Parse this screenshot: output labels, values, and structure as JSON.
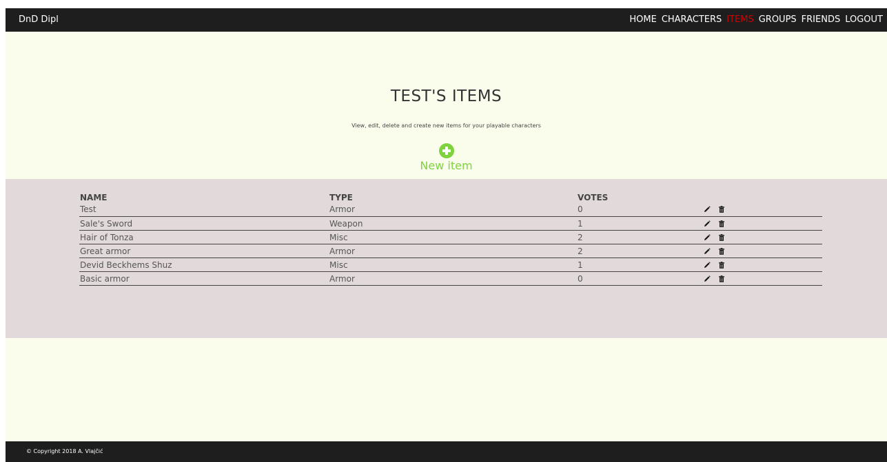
{
  "navbar": {
    "brand": "DnD Dipl",
    "links": [
      {
        "label": "HOME",
        "active": false
      },
      {
        "label": "CHARACTERS",
        "active": false
      },
      {
        "label": "ITEMS",
        "active": true
      },
      {
        "label": "GROUPS",
        "active": false
      },
      {
        "label": "FRIENDS",
        "active": false
      },
      {
        "label": "LOGOUT",
        "active": false
      }
    ],
    "active_color": "#d40000"
  },
  "header": {
    "title": "TEST'S ITEMS",
    "subtitle": "View, edit, delete and create new items for your playable characters",
    "new_item_label": "New item",
    "new_item_icon": "plus-circle-icon",
    "accent_color": "#7ed33f"
  },
  "table": {
    "columns": [
      "NAME",
      "TYPE",
      "VOTES"
    ],
    "rows": [
      {
        "name": "Test",
        "type": "Armor",
        "votes": "0"
      },
      {
        "name": "Sale's Sword",
        "type": "Weapon",
        "votes": "1"
      },
      {
        "name": "Hair of Tonza",
        "type": "Misc",
        "votes": "2"
      },
      {
        "name": "Great armor",
        "type": "Armor",
        "votes": "2"
      },
      {
        "name": "Devid Beckhems Shuz",
        "type": "Misc",
        "votes": "1"
      },
      {
        "name": "Basic armor",
        "type": "Armor",
        "votes": "0"
      }
    ],
    "row_actions": [
      "pencil-icon",
      "trash-icon"
    ]
  },
  "footer": {
    "copyright": "© Copyright 2018 A. Vlajčić"
  },
  "colors": {
    "page_bg": "#fbfdec",
    "content_bg": "#e2d9da",
    "bar_bg": "#1e1e1e"
  }
}
